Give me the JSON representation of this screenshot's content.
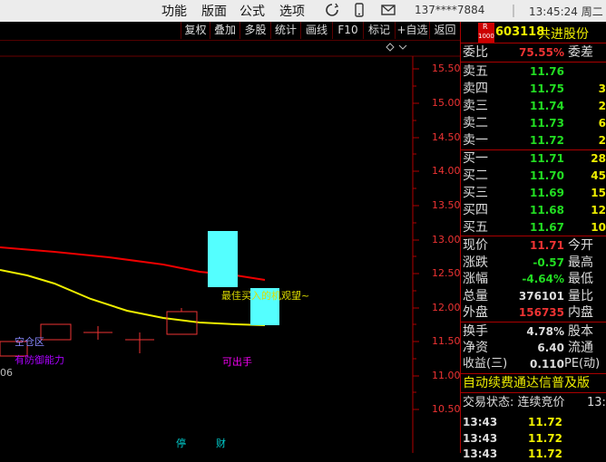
{
  "menu": {
    "items": [
      "功能",
      "版面",
      "公式",
      "选项"
    ],
    "phone": "137****7884",
    "clock": "13:45:24 周二"
  },
  "toolbar": {
    "buttons": [
      "复权",
      "叠加",
      "多股",
      "统计",
      "画线",
      "F10",
      "标记",
      "+自选",
      "返回"
    ]
  },
  "chart": {
    "price_labels": [
      "15.50",
      "15.00",
      "14.50",
      "14.00",
      "13.50",
      "13.00",
      "12.50",
      "12.00",
      "11.50",
      "11.00",
      "10.50"
    ],
    "annotations": {
      "a1": "最佳买入的机观望~",
      "a2": "可出手",
      "a3": "空仓区",
      "a4": "有防御能力",
      "date": "06"
    },
    "bottom_tags": [
      "停",
      "财"
    ]
  },
  "stock": {
    "badge_top": "R",
    "badge_bottom": "1000",
    "code": "603118",
    "name": "共进股份"
  },
  "order": {
    "weibi_label": "委比",
    "weibi_value": "75.55%",
    "weicha_label": "委差",
    "asks": [
      {
        "label": "卖五",
        "price": "11.76",
        "vol": ""
      },
      {
        "label": "卖四",
        "price": "11.75",
        "vol": "3"
      },
      {
        "label": "卖三",
        "price": "11.74",
        "vol": "2"
      },
      {
        "label": "卖二",
        "price": "11.73",
        "vol": "6"
      },
      {
        "label": "卖一",
        "price": "11.72",
        "vol": "2"
      }
    ],
    "bids": [
      {
        "label": "买一",
        "price": "11.71",
        "vol": "28"
      },
      {
        "label": "买二",
        "price": "11.70",
        "vol": "45"
      },
      {
        "label": "买三",
        "price": "11.69",
        "vol": "15"
      },
      {
        "label": "买四",
        "price": "11.68",
        "vol": "12"
      },
      {
        "label": "买五",
        "price": "11.67",
        "vol": "10"
      }
    ]
  },
  "quote": {
    "rows": [
      {
        "l": "现价",
        "v": "11.71",
        "r": "今开",
        "color": "#e33"
      },
      {
        "l": "涨跌",
        "v": "-0.57",
        "r": "最高",
        "color": "#2d2"
      },
      {
        "l": "涨幅",
        "v": "-4.64%",
        "r": "最低",
        "color": "#2d2"
      },
      {
        "l": "总量",
        "v": "376101",
        "r": "量比",
        "color": "#ddd"
      },
      {
        "l": "外盘",
        "v": "156735",
        "r": "内盘",
        "color": "#e33"
      }
    ],
    "rows2": [
      {
        "l": "换手",
        "v": "4.78%",
        "r": "股本"
      },
      {
        "l": "净资",
        "v": "6.40",
        "r": "流通"
      },
      {
        "l": "收益(三)",
        "v": "0.110",
        "r": "PE(动)"
      }
    ]
  },
  "ticker": "自动续费通达信普及版",
  "trade": {
    "status_label": "交易状态: 连续竞价",
    "status_time": "13:"
  },
  "ticks": [
    {
      "time": "13:43",
      "price": "11.72"
    },
    {
      "time": "13:43",
      "price": "11.72"
    },
    {
      "time": "13:43",
      "price": "11.72"
    }
  ]
}
